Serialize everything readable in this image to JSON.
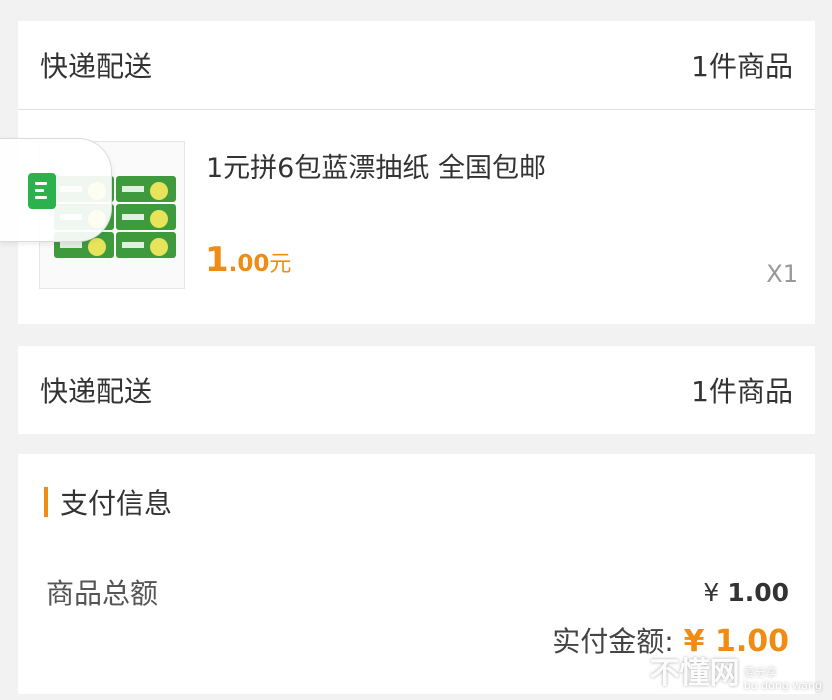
{
  "delivery_card": {
    "method": "快递配送",
    "item_count": "1件商品"
  },
  "product": {
    "title": "1元拼6包蓝漂抽纸 全国包邮",
    "price_int": "1",
    "price_dec": ".00",
    "price_unit": "元",
    "quantity": "X1"
  },
  "delivery_card_2": {
    "method": "快递配送",
    "item_count": "1件商品"
  },
  "payment": {
    "section_title": "支付信息",
    "goods_total_label": "商品总额",
    "goods_total_currency": "¥",
    "goods_total_value": "1.00",
    "actual_label": "实付金额:",
    "actual_value": "¥ 1.00"
  },
  "watermark": {
    "brand": "不懂网",
    "tagline_cn": "爱分享",
    "tagline_py": "bu dong wang"
  },
  "colors": {
    "accent": "#f08c14",
    "background": "#f2f2f2"
  },
  "icons": [
    "document-icon",
    "tissue-product-image"
  ]
}
